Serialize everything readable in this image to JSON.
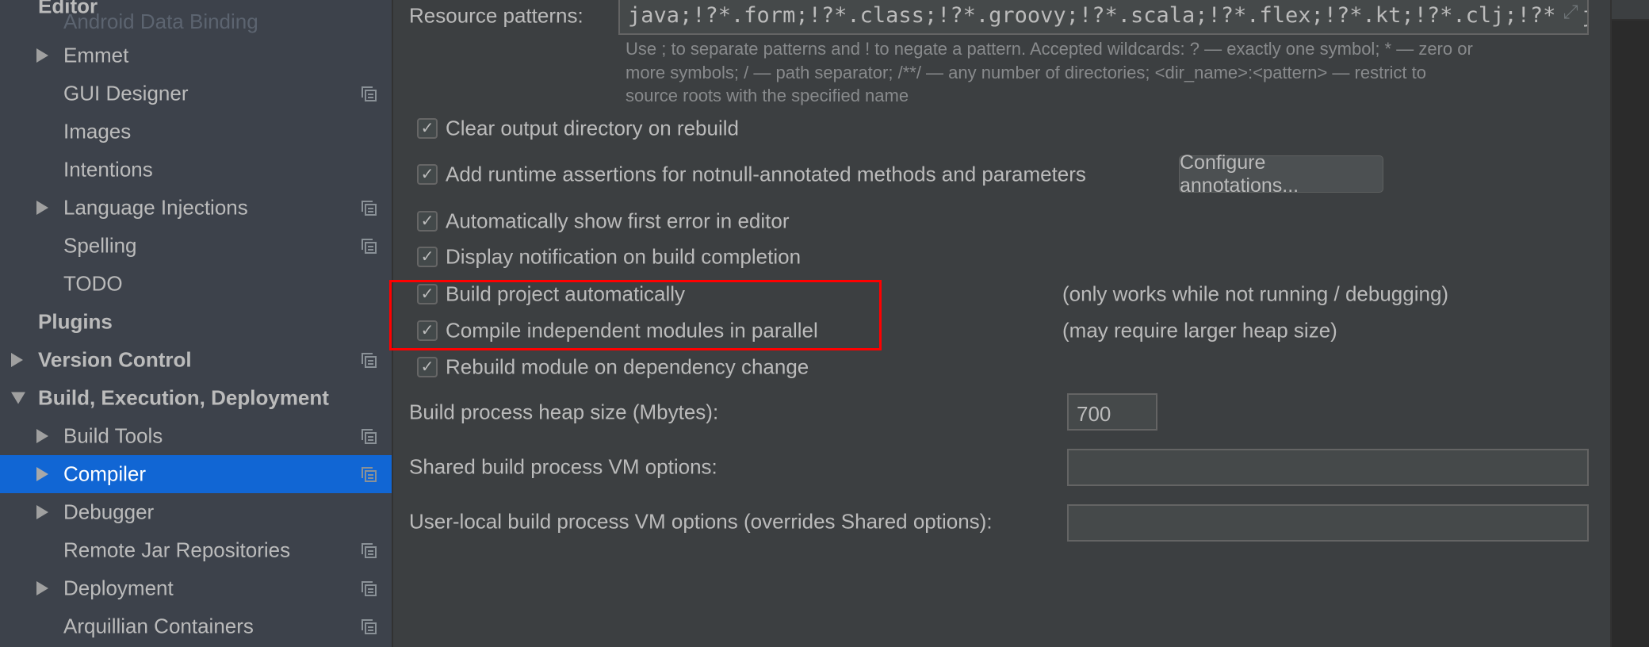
{
  "sidebar": {
    "faded_item": "Android Data Binding",
    "items": [
      {
        "label": "Editor",
        "level": 0
      },
      {
        "label": "Emmet",
        "level": 1,
        "arrow": "collapsed"
      },
      {
        "label": "GUI Designer",
        "level": 1,
        "copy_icon": true
      },
      {
        "label": "Images",
        "level": 1
      },
      {
        "label": "Intentions",
        "level": 1
      },
      {
        "label": "Language Injections",
        "level": 1,
        "arrow": "collapsed",
        "copy_icon": true
      },
      {
        "label": "Spelling",
        "level": 1,
        "copy_icon": true
      },
      {
        "label": "TODO",
        "level": 1
      },
      {
        "label": "Plugins",
        "level": 0
      },
      {
        "label": "Version Control",
        "level": 0,
        "arrow": "collapsed",
        "copy_icon": true
      },
      {
        "label": "Build, Execution, Deployment",
        "level": 0,
        "arrow": "expanded"
      },
      {
        "label": "Build Tools",
        "level": 1,
        "arrow": "collapsed",
        "copy_icon": true
      },
      {
        "label": "Compiler",
        "level": 1,
        "arrow": "collapsed",
        "copy_icon": true,
        "selected": true
      },
      {
        "label": "Debugger",
        "level": 1,
        "arrow": "collapsed"
      },
      {
        "label": "Remote Jar Repositories",
        "level": 1,
        "copy_icon": true
      },
      {
        "label": "Deployment",
        "level": 1,
        "arrow": "collapsed",
        "copy_icon": true
      },
      {
        "label": "Arquillian Containers",
        "level": 1,
        "copy_icon": true
      }
    ]
  },
  "main": {
    "resource_patterns_label": "Resource patterns:",
    "resource_patterns_value": "java;!?*.form;!?*.class;!?*.groovy;!?*.scala;!?*.flex;!?*.kt;!?*.clj;!?*.aj",
    "help_lines": [
      "Use ; to separate patterns and ! to negate a pattern. Accepted wildcards: ? — exactly one symbol; * — zero or",
      "more symbols; / — path separator; /**/ — any number of directories; <dir_name>:<pattern> — restrict to",
      "source roots with the specified name"
    ],
    "checkboxes": [
      {
        "label": "Clear output directory on rebuild",
        "checked": true
      },
      {
        "label": "Add runtime assertions for notnull-annotated methods and parameters",
        "checked": true
      },
      {
        "label": "Automatically show first error in editor",
        "checked": true
      },
      {
        "label": "Display notification on build completion",
        "checked": true
      },
      {
        "label": "Build project automatically",
        "checked": true,
        "note": "(only works while not running / debugging)"
      },
      {
        "label": "Compile independent modules in parallel",
        "checked": true,
        "note": "(may require larger heap size)"
      },
      {
        "label": "Rebuild module on dependency change",
        "checked": true
      }
    ],
    "configure_button": "Configure annotations...",
    "heap_label": "Build process heap size (Mbytes):",
    "heap_value": "700",
    "shared_vm_label": "Shared build process VM options:",
    "shared_vm_value": "",
    "user_vm_label": "User-local build process VM options (overrides Shared options):",
    "user_vm_value": "",
    "highlight_color": "#ff0000",
    "selection_color": "#1166d4"
  }
}
